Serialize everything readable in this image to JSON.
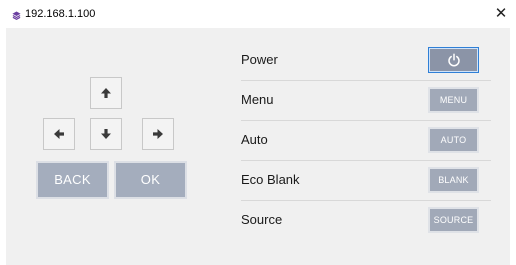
{
  "window": {
    "title": "192.168.1.100",
    "close_label": "✕",
    "app_icon": "stacked-layers-icon",
    "accent_color": "#6b3fa0"
  },
  "dpad": {
    "up_icon": "arrow-up-icon",
    "left_icon": "arrow-left-icon",
    "down_icon": "arrow-down-icon",
    "right_icon": "arrow-right-icon",
    "back_label": "BACK",
    "ok_label": "OK"
  },
  "controls": [
    {
      "label": "Power",
      "button_label": "",
      "button_icon": "power-icon"
    },
    {
      "label": "Menu",
      "button_label": "MENU"
    },
    {
      "label": "Auto",
      "button_label": "AUTO"
    },
    {
      "label": "Eco Blank",
      "button_label": "BLANK"
    },
    {
      "label": "Source",
      "button_label": "SOURCE"
    }
  ],
  "colors": {
    "button_fill": "#a1a9b8",
    "power_button_fill": "#8b94a7",
    "focus_border": "#2f7fd6",
    "panel_bg": "#f0f0f0"
  }
}
